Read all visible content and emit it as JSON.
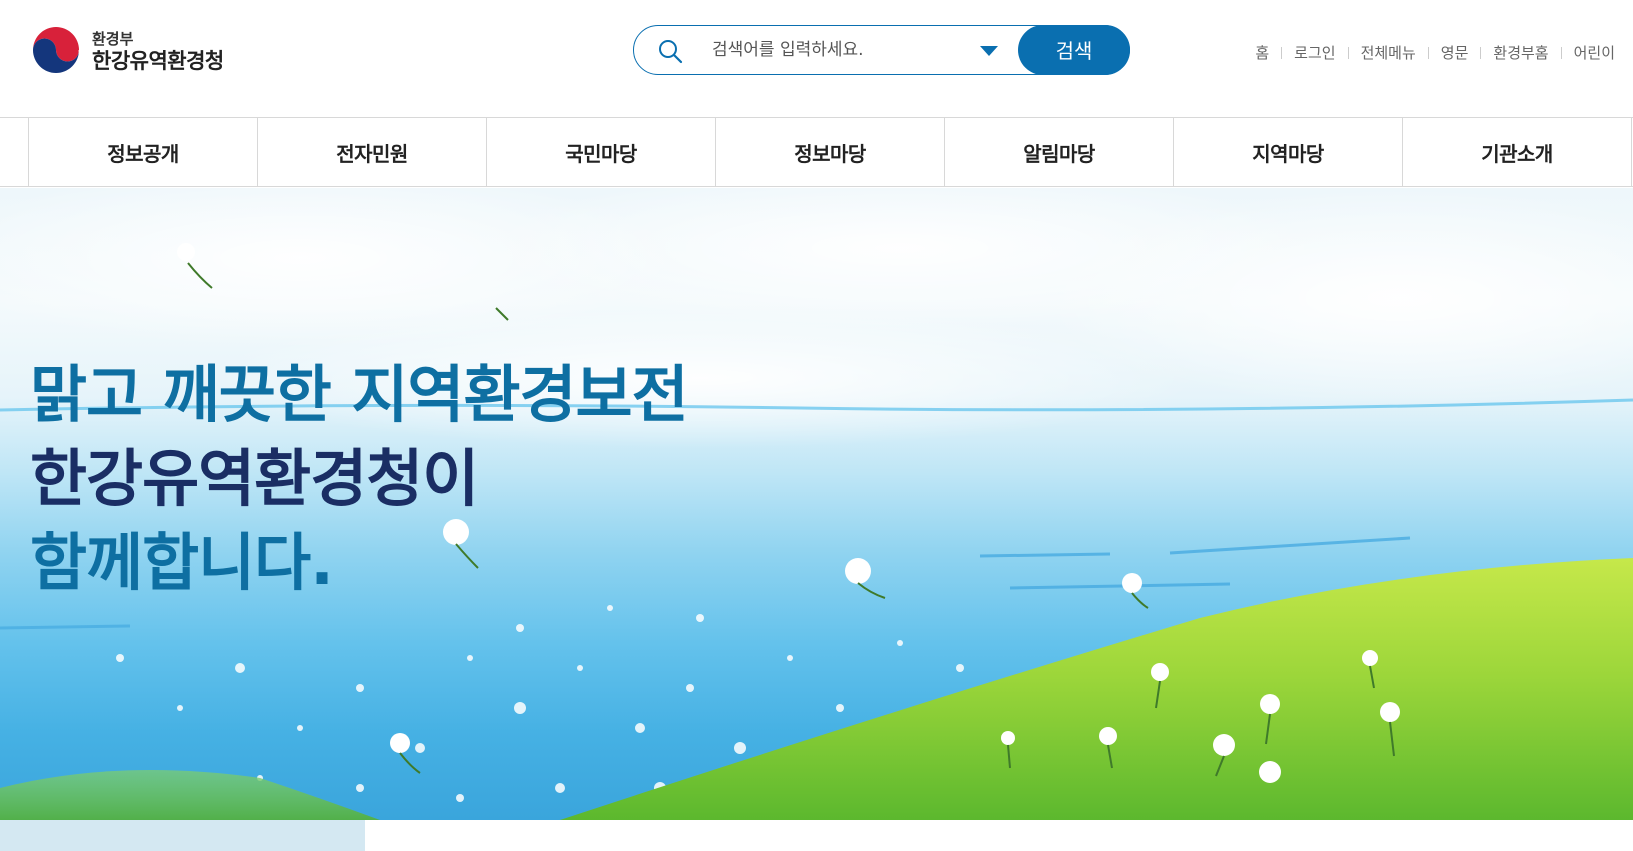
{
  "header": {
    "logo": {
      "ministry": "환경부",
      "name": "한강유역환경청"
    },
    "search": {
      "placeholder": "검색어를 입력하세요.",
      "button_label": "검색"
    },
    "util_links": [
      "홈",
      "로그인",
      "전체메뉴",
      "영문",
      "환경부홈",
      "어린이"
    ]
  },
  "nav": {
    "items": [
      "정보공개",
      "전자민원",
      "국민마당",
      "정보마당",
      "알림마당",
      "지역마당",
      "기관소개"
    ]
  },
  "hero": {
    "line1": "맑고 깨끗한 지역환경보전",
    "line2": "한강유역환경청이",
    "line3": "함께합니다."
  },
  "colors": {
    "accent": "#0a6fb0",
    "hero_text_blue": "#0e6fa2",
    "hero_text_navy": "#1a2e64",
    "meadow_green": "#9cd63a"
  },
  "icons": {
    "logo": "taegeuk-emblem-icon",
    "search": "search-icon",
    "dropdown": "triangle-down-icon"
  }
}
